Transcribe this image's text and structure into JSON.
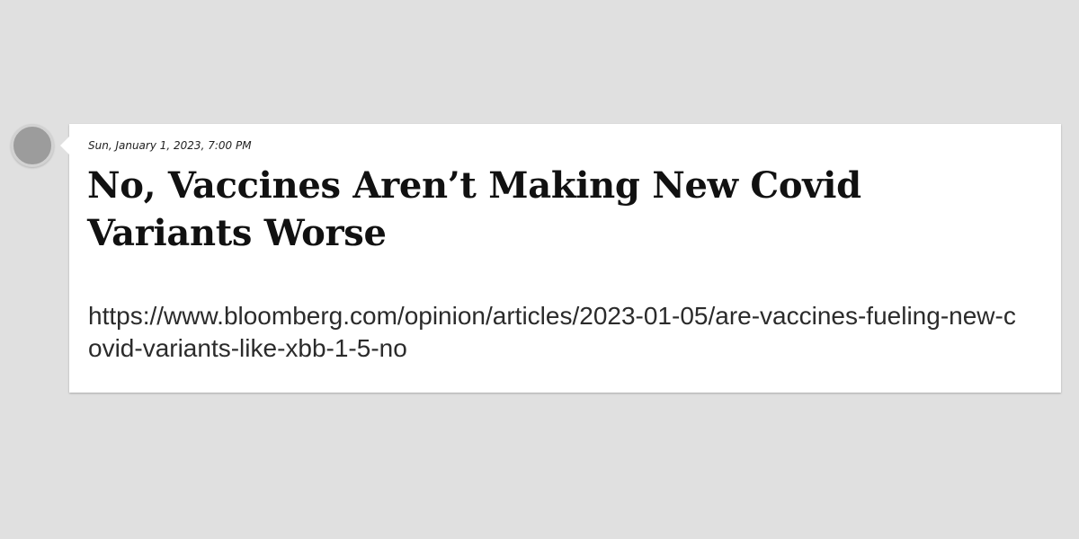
{
  "post": {
    "timestamp": "Sun, January 1, 2023, 7:00 PM",
    "headline": "No, Vaccines Aren’t Making New Covid Variants Worse",
    "url": "https://www.bloomberg.com/opinion/articles/2023-01-05/are-vaccines-fueling-new-covid-variants-like-xbb-1-5-no"
  },
  "avatar": {
    "icon": "avatar-circle",
    "color": "#9c9c9c"
  },
  "colors": {
    "background": "#e0e0e0",
    "card": "#ffffff",
    "text": "#111111"
  }
}
